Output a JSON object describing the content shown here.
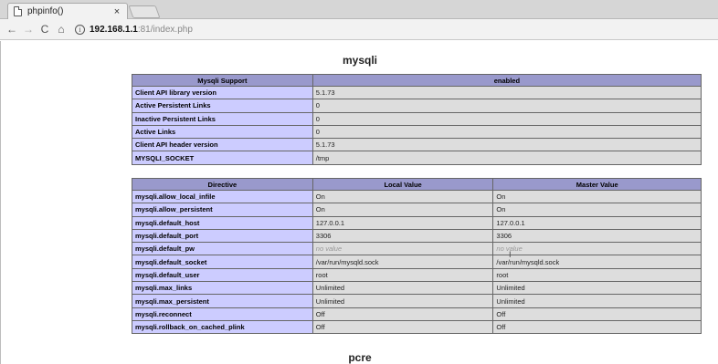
{
  "browser": {
    "tab_title": "phpinfo()",
    "tab_close": "×",
    "url_host": "192.168.1.1",
    "url_rest": ":81/index.php",
    "back": "←",
    "forward": "→",
    "reload": "C",
    "home": "⌂",
    "info": "i"
  },
  "mysqli": {
    "heading": "mysqli",
    "support_headers": [
      "Mysqli Support",
      "enabled"
    ],
    "support_rows": [
      {
        "label": "Client API library version",
        "value": "5.1.73"
      },
      {
        "label": "Active Persistent Links",
        "value": "0"
      },
      {
        "label": "Inactive Persistent Links",
        "value": "0"
      },
      {
        "label": "Active Links",
        "value": "0"
      },
      {
        "label": "Client API header version",
        "value": "5.1.73"
      },
      {
        "label": "MYSQLI_SOCKET",
        "value": "/tmp"
      }
    ],
    "directive_headers": [
      "Directive",
      "Local Value",
      "Master Value"
    ],
    "directive_rows": [
      {
        "name": "mysqli.allow_local_infile",
        "local": "On",
        "master": "On"
      },
      {
        "name": "mysqli.allow_persistent",
        "local": "On",
        "master": "On"
      },
      {
        "name": "mysqli.default_host",
        "local": "127.0.0.1",
        "master": "127.0.0.1"
      },
      {
        "name": "mysqli.default_port",
        "local": "3306",
        "master": "3306"
      },
      {
        "name": "mysqli.default_pw",
        "local": "no value",
        "master": "no value"
      },
      {
        "name": "mysqli.default_socket",
        "local": "/var/run/mysqld.sock",
        "master": "/var/run/mysqld.sock"
      },
      {
        "name": "mysqli.default_user",
        "local": "root",
        "master": "root"
      },
      {
        "name": "mysqli.max_links",
        "local": "Unlimited",
        "master": "Unlimited"
      },
      {
        "name": "mysqli.max_persistent",
        "local": "Unlimited",
        "master": "Unlimited"
      },
      {
        "name": "mysqli.reconnect",
        "local": "Off",
        "master": "Off"
      },
      {
        "name": "mysqli.rollback_on_cached_plink",
        "local": "Off",
        "master": "Off"
      }
    ]
  },
  "pcre": {
    "heading": "pcre"
  }
}
